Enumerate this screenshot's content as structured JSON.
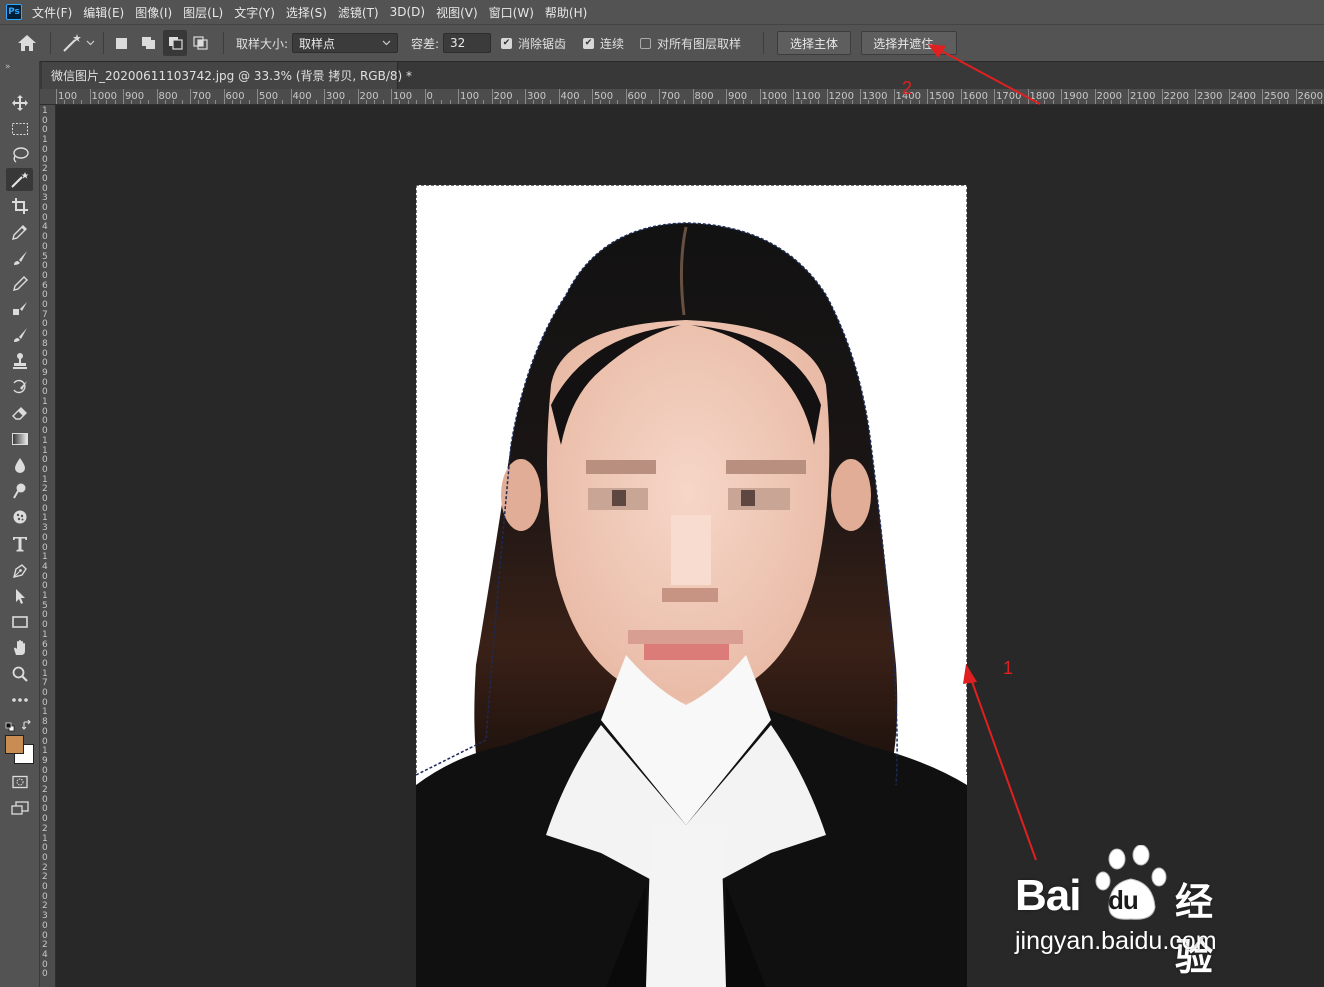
{
  "menubar": {
    "logo": "Ps",
    "items": [
      "文件(F)",
      "编辑(E)",
      "图像(I)",
      "图层(L)",
      "文字(Y)",
      "选择(S)",
      "滤镜(T)",
      "3D(D)",
      "视图(V)",
      "窗口(W)",
      "帮助(H)"
    ]
  },
  "options": {
    "sample_size_label": "取样大小:",
    "sample_size_value": "取样点",
    "tolerance_label": "容差:",
    "tolerance_value": "32",
    "antialias_label": "消除锯齿",
    "antialias_checked": true,
    "contiguous_label": "连续",
    "contiguous_checked": true,
    "sample_all_layers_label": "对所有图层取样",
    "sample_all_layers_checked": false,
    "select_subject_label": "选择主体",
    "select_and_mask_label": "选择并遮住..."
  },
  "document": {
    "tab_title": "微信图片_20200611103742.jpg @ 33.3% (背景 拷贝, RGB/8) *"
  },
  "ruler": {
    "top_labels": [
      "100",
      "1000",
      "900",
      "800",
      "700",
      "600",
      "500",
      "400",
      "300",
      "200",
      "100",
      "0",
      "100",
      "200",
      "300",
      "400",
      "500",
      "600",
      "700",
      "800",
      "900",
      "1000",
      "1100",
      "1200",
      "1300",
      "1400",
      "1500",
      "1600",
      "1700",
      "1800",
      "1900",
      "2000",
      "2100",
      "2200",
      "2300",
      "2400",
      "2500",
      "2600"
    ],
    "left_labels": [
      "1",
      "0",
      "0",
      "1",
      "0",
      "0",
      "2",
      "0",
      "0",
      "3",
      "0",
      "0",
      "4",
      "0",
      "0",
      "5",
      "0",
      "0",
      "6",
      "0",
      "0",
      "7",
      "0",
      "0",
      "8",
      "0",
      "0",
      "9",
      "0",
      "0",
      "1",
      "0",
      "0",
      "0",
      "1",
      "1",
      "0",
      "0",
      "1",
      "2",
      "0",
      "0",
      "1",
      "3",
      "0",
      "0",
      "1",
      "4",
      "0",
      "0",
      "1",
      "5",
      "0",
      "0",
      "1",
      "6",
      "0",
      "0",
      "1",
      "7",
      "0",
      "0",
      "1",
      "8",
      "0",
      "0",
      "1",
      "9",
      "0",
      "0",
      "2",
      "0",
      "0",
      "0",
      "2",
      "1",
      "0",
      "0",
      "2",
      "2",
      "0",
      "0",
      "2",
      "3",
      "0",
      "0",
      "2",
      "4",
      "0",
      "0"
    ]
  },
  "colors": {
    "foreground": "#c98c52",
    "background": "#ffffff",
    "annotation": "#e02020"
  },
  "annotations": {
    "label_1": "1",
    "label_2": "2"
  },
  "watermark": {
    "brand": "Bai",
    "brand_du": "du",
    "brand_cn": "经验",
    "url": "jingyan.baidu.com"
  }
}
